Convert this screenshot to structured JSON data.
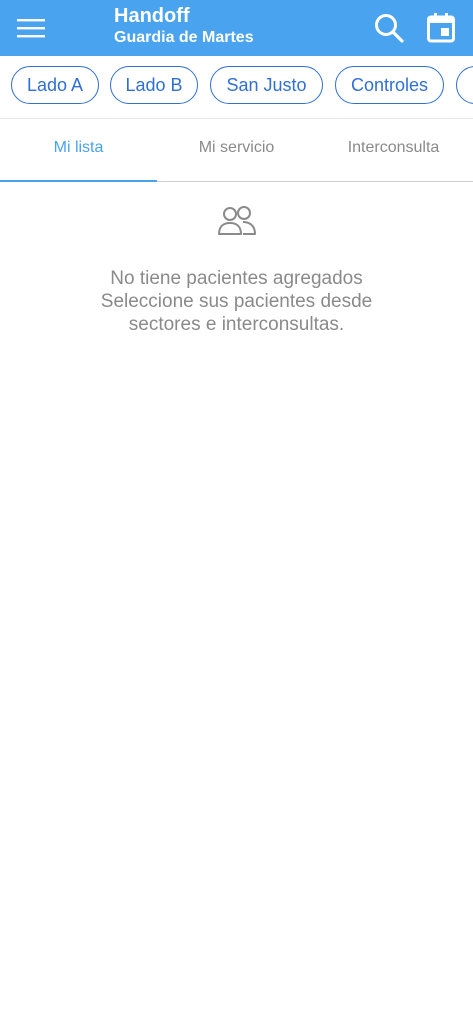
{
  "header": {
    "title": "Handoff",
    "subtitle": "Guardia de Martes",
    "color": "#4aa3ef",
    "icons": {
      "menu": "menu-icon",
      "search": "search-icon",
      "calendar": "calendar-icon"
    }
  },
  "chips": [
    {
      "label": "Lado A"
    },
    {
      "label": "Lado B"
    },
    {
      "label": "San Justo"
    },
    {
      "label": "Controles"
    }
  ],
  "tabs": [
    {
      "label": "Mi lista",
      "active": true
    },
    {
      "label": "Mi servicio",
      "active": false
    },
    {
      "label": "Interconsulta",
      "active": false
    }
  ],
  "empty_state": {
    "icon": "people-icon",
    "line1": "No tiene pacientes agregados",
    "line2": "Seleccione sus pacientes desde",
    "line3": "sectores e interconsultas."
  },
  "colors": {
    "accent": "#4aa3ef",
    "chip": "#2f6fd6",
    "muted_text": "#8a8a8a"
  }
}
